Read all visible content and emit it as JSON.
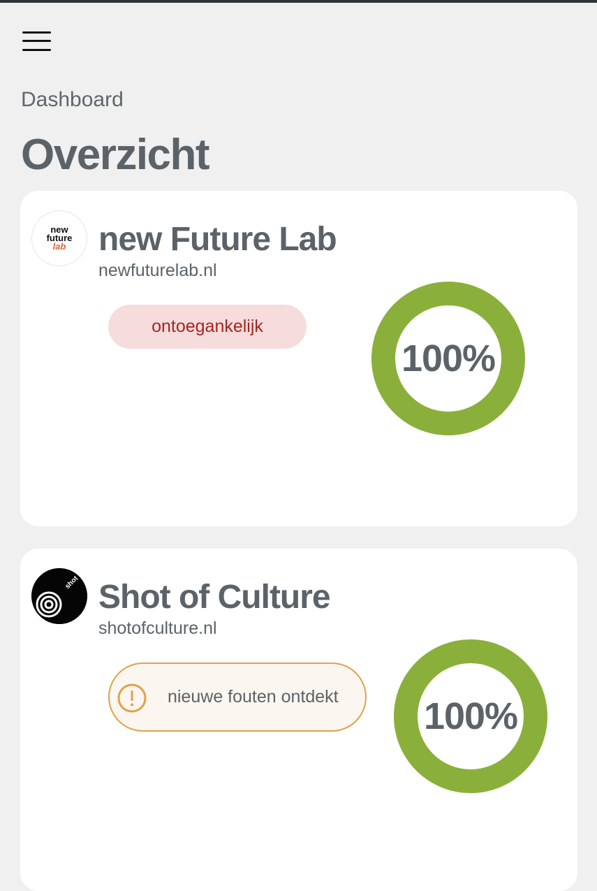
{
  "header": {
    "menu_icon": "hamburger-menu-icon",
    "breadcrumb": "Dashboard",
    "title": "Overzicht"
  },
  "colors": {
    "gauge_fill": "#8ab03b",
    "danger_bg": "#f6dcdc",
    "danger_text": "#a52621",
    "warning_border": "#e0a24a",
    "warning_bg": "#fbf6ef",
    "text": "#5b6369"
  },
  "sites": [
    {
      "name": "new Future Lab",
      "url": "newfuturelab.nl",
      "logo_lines": [
        "new",
        "future",
        "lab"
      ],
      "status": "ontoegankelijk",
      "status_type": "danger",
      "score": 1.0,
      "score_label": "100%"
    },
    {
      "name": "Shot of Culture",
      "url": "shotofculture.nl",
      "logo_text": "shot of culture",
      "status": "nieuwe fouten ontdekt",
      "status_type": "warning",
      "status_icon": "exclamation-circle-icon",
      "score": 1.0,
      "score_label": "100%"
    }
  ]
}
